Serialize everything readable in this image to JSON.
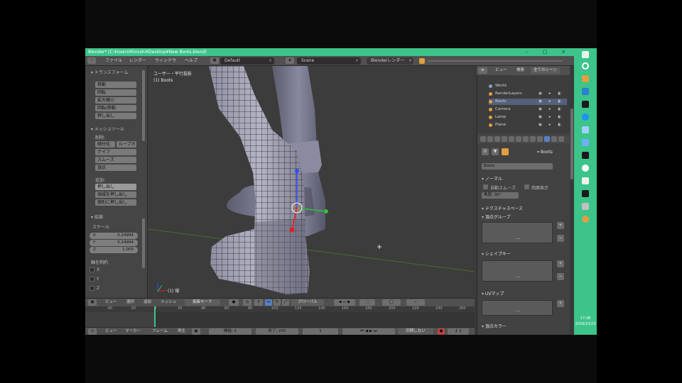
{
  "window": {
    "title": "Blender* [C:¥Users¥hiroshi¥Desktop¥New Boots.blend]",
    "controls": [
      "–",
      "□",
      "×"
    ]
  },
  "infobar": {
    "menus": [
      "ファイル",
      "レンダー",
      "ウィンドウ",
      "ヘルプ"
    ],
    "layout_field": "Default",
    "scene_field": "Scene",
    "render_engine": "Blenderレンダー"
  },
  "toolshelf": {
    "section_transform": "▾ トランスフォーム",
    "transform_buttons": [
      "移動",
      "回転",
      "拡大縮小",
      "回転/移動",
      "押し出し"
    ],
    "section_mesh": "▾ メッシュツール",
    "mesh_label": "削除:",
    "mesh_buttons": [
      "細分化",
      "ループカット",
      "ナイフ",
      "スムーズ",
      "頂点"
    ],
    "add_label": "追加:",
    "add_buttons": [
      "押し出し",
      "領域を押し出し",
      "個別に押し出し"
    ],
    "section_op": "▾ 拡縮",
    "op_subtitle": "スケール",
    "num_fields": [
      {
        "label": "X",
        "value": "0.24994"
      },
      {
        "label": "Y",
        "value": "0.24994"
      },
      {
        "label": "Z",
        "value": "1.000"
      }
    ],
    "constraint_label": "軸を制約",
    "checkboxes": [
      "X",
      "Y",
      "Z"
    ]
  },
  "viewport": {
    "view_label": "ユーザー・平行投影",
    "object_label": "(1) Boots",
    "axis_label": "(1) 縦"
  },
  "viewport_header": {
    "menus": [
      "ビュー",
      "選択",
      "追加",
      "メッシュ"
    ],
    "mode": "編集モード",
    "pivot": "グローバル"
  },
  "timeline": {
    "ticks": [
      "-40",
      "-20",
      "0",
      "20",
      "40",
      "60",
      "80",
      "100",
      "120",
      "140",
      "160",
      "180",
      "200",
      "220",
      "240",
      "260"
    ],
    "menus": [
      "ビュー",
      "マーカー",
      "フレーム",
      "再生"
    ],
    "start_field": "開始: 1",
    "end_field": "終了: 250",
    "current_frame": "1",
    "sync": "同期しない"
  },
  "outliner": {
    "tabs": [
      "ビュー",
      "検索",
      "全てのシーン"
    ],
    "rows": [
      "World",
      "RenderLayers",
      "Boots",
      "Camera",
      "Lamp",
      "Plane"
    ]
  },
  "properties": {
    "data_name": "Boots",
    "panel_normals": "ノーマル",
    "auto_smooth": "自動スムーズ",
    "double_sided": "両面表示",
    "angle_field": "角度: 30°",
    "panel_texture_space": "テクスチャスペース",
    "panel_vertex_groups": "頂点グループ",
    "panel_shape_keys": "シェイプキー",
    "panel_uv_maps": "UVマップ",
    "panel_vertex_colors": "頂点カラー",
    "list_dots": "....",
    "add_symbol": "+",
    "remove_symbol": "−"
  },
  "taskbar": {
    "clock_time": "17:38",
    "clock_date": "2016/10/23"
  },
  "colors": {
    "accent_green": "#3cc48a",
    "selection_orange": "#e0a040"
  }
}
